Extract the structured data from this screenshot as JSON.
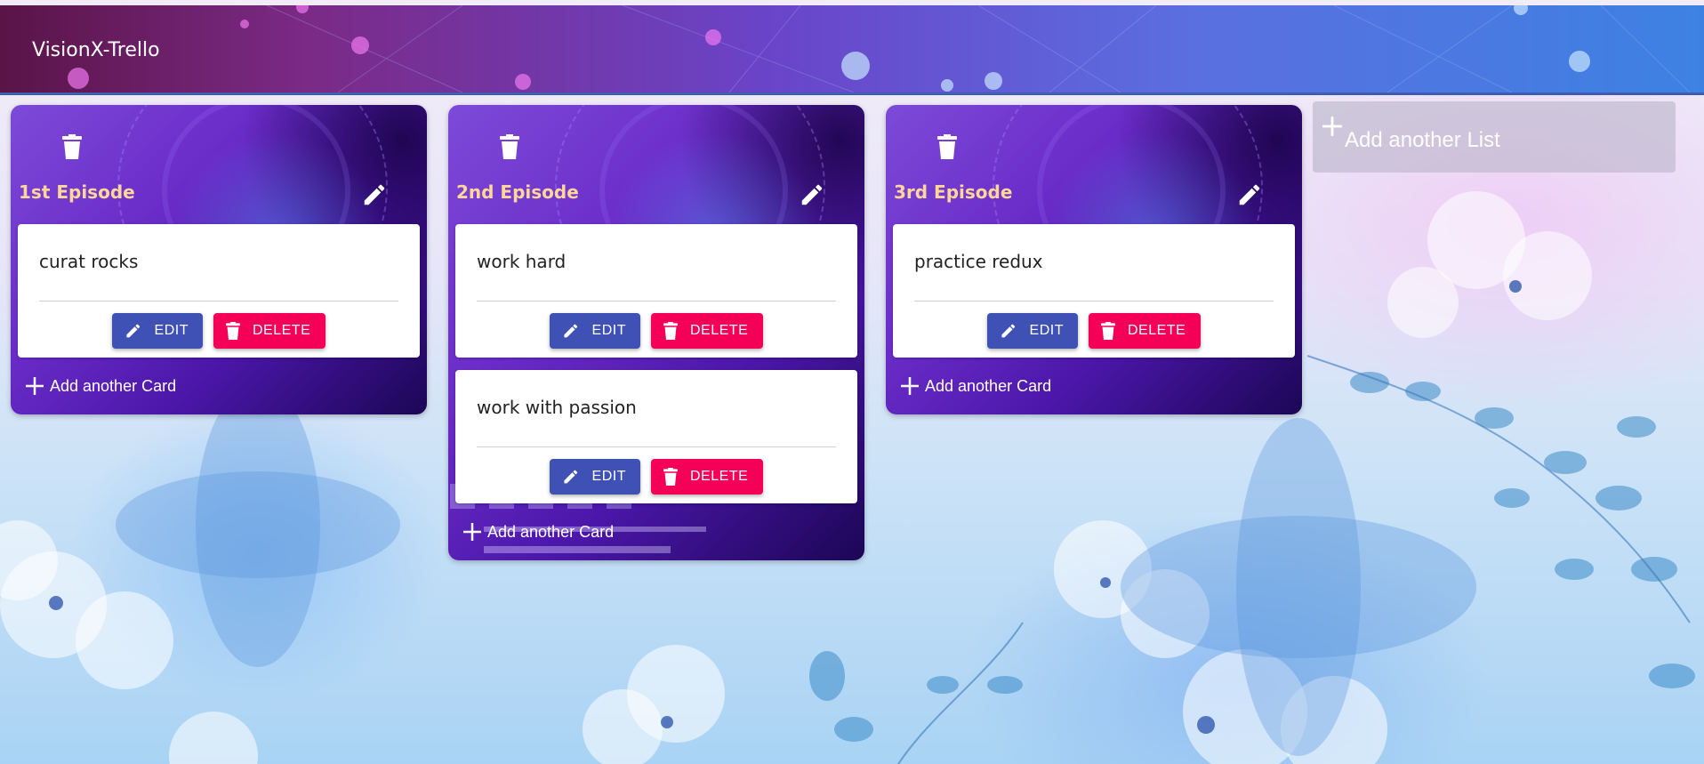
{
  "app": {
    "title": "VisionX-Trello"
  },
  "lists": [
    {
      "title": "1st Episode",
      "add_card_label": "Add another Card",
      "cards": [
        {
          "text": "curat rocks",
          "edit_label": "EDIT",
          "delete_label": "DELETE"
        }
      ]
    },
    {
      "title": "2nd Episode",
      "add_card_label": "Add another Card",
      "cards": [
        {
          "text": "work hard",
          "edit_label": "EDIT",
          "delete_label": "DELETE"
        },
        {
          "text": "work with passion",
          "edit_label": "EDIT",
          "delete_label": "DELETE"
        }
      ]
    },
    {
      "title": "3rd Episode",
      "add_card_label": "Add another Card",
      "cards": [
        {
          "text": "practice redux",
          "edit_label": "EDIT",
          "delete_label": "DELETE"
        }
      ]
    }
  ],
  "add_list_label": "Add another List",
  "colors": {
    "edit_button": "#3f51b5",
    "delete_button": "#f50057",
    "list_title": "#ffd699",
    "add_list_bg": "#b9b4c8"
  },
  "icons": {
    "list_delete": "trash-icon",
    "list_edit": "pencil-icon",
    "card_edit": "pencil-icon",
    "card_delete": "trash-icon",
    "add": "plus-icon"
  }
}
